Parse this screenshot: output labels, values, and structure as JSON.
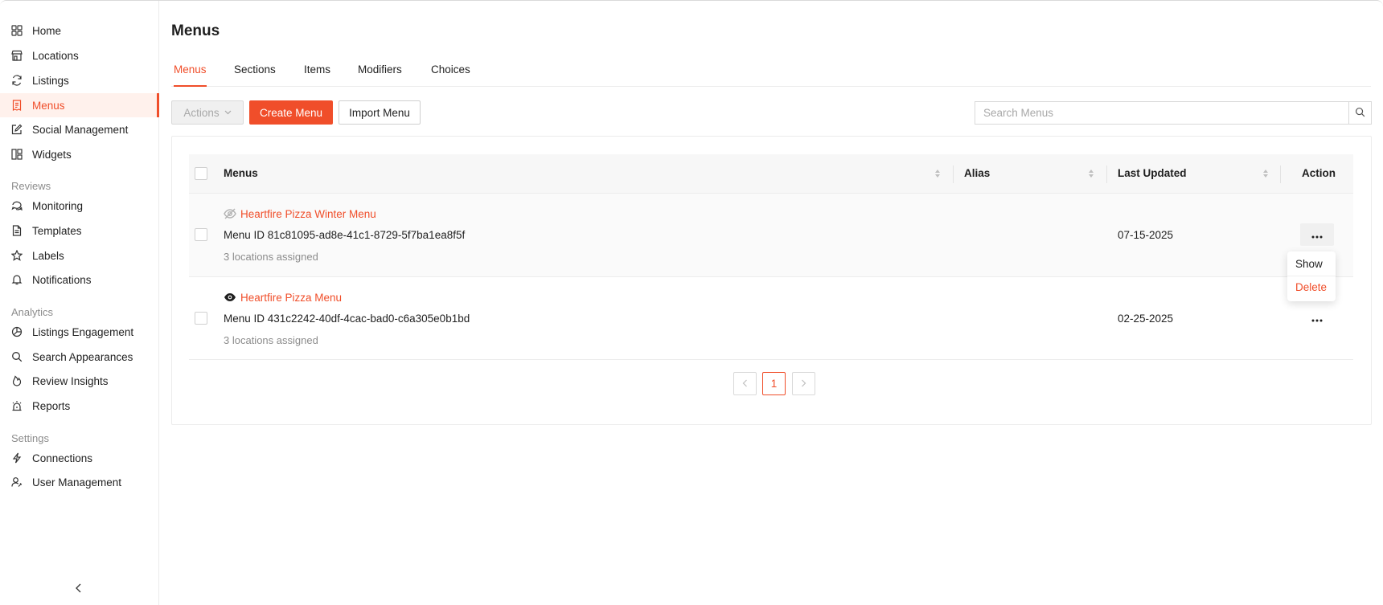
{
  "sidebar": {
    "items": [
      {
        "label": "Home",
        "icon": "grid-icon"
      },
      {
        "label": "Locations",
        "icon": "store-icon"
      },
      {
        "label": "Listings",
        "icon": "refresh-icon"
      },
      {
        "label": "Menus",
        "icon": "receipt-icon",
        "active": true
      },
      {
        "label": "Social Management",
        "icon": "edit-icon"
      },
      {
        "label": "Widgets",
        "icon": "widgets-icon"
      }
    ],
    "reviews_heading": "Reviews",
    "reviews_items": [
      {
        "label": "Monitoring",
        "icon": "chat-icon"
      },
      {
        "label": "Templates",
        "icon": "document-icon"
      },
      {
        "label": "Labels",
        "icon": "star-icon"
      },
      {
        "label": "Notifications",
        "icon": "bell-icon"
      }
    ],
    "analytics_heading": "Analytics",
    "analytics_items": [
      {
        "label": "Listings Engagement",
        "icon": "pie-chart-icon"
      },
      {
        "label": "Search Appearances",
        "icon": "search-icon"
      },
      {
        "label": "Review Insights",
        "icon": "flame-icon"
      },
      {
        "label": "Reports",
        "icon": "alarm-icon"
      }
    ],
    "settings_heading": "Settings",
    "settings_items": [
      {
        "label": "Connections",
        "icon": "bolt-icon"
      },
      {
        "label": "User Management",
        "icon": "users-icon"
      }
    ]
  },
  "page": {
    "title": "Menus"
  },
  "tabs": [
    "Menus",
    "Sections",
    "Items",
    "Modifiers",
    "Choices"
  ],
  "toolbar": {
    "actions_label": "Actions",
    "create_label": "Create Menu",
    "import_label": "Import Menu",
    "search_placeholder": "Search Menus"
  },
  "table": {
    "columns": [
      "Menus",
      "Alias",
      "Last Updated",
      "Action"
    ],
    "rows": [
      {
        "name": "Heartfire Pizza Winter Menu",
        "visibility": "hidden",
        "menu_id": "Menu ID 81c81095-ad8e-41c1-8729-5f7ba1ea8f5f",
        "locations": "3 locations assigned",
        "alias": "",
        "last_updated": "07-15-2025"
      },
      {
        "name": "Heartfire Pizza Menu",
        "visibility": "visible",
        "menu_id": "Menu ID 431c2242-40df-4cac-bad0-c6a305e0b1bd",
        "locations": "3 locations assigned",
        "alias": "",
        "last_updated": "02-25-2025"
      }
    ]
  },
  "dropdown": {
    "show": "Show",
    "delete": "Delete"
  },
  "pagination": {
    "current": "1"
  },
  "colors": {
    "accent": "#f04e2a",
    "muted": "#8c8c8c"
  }
}
